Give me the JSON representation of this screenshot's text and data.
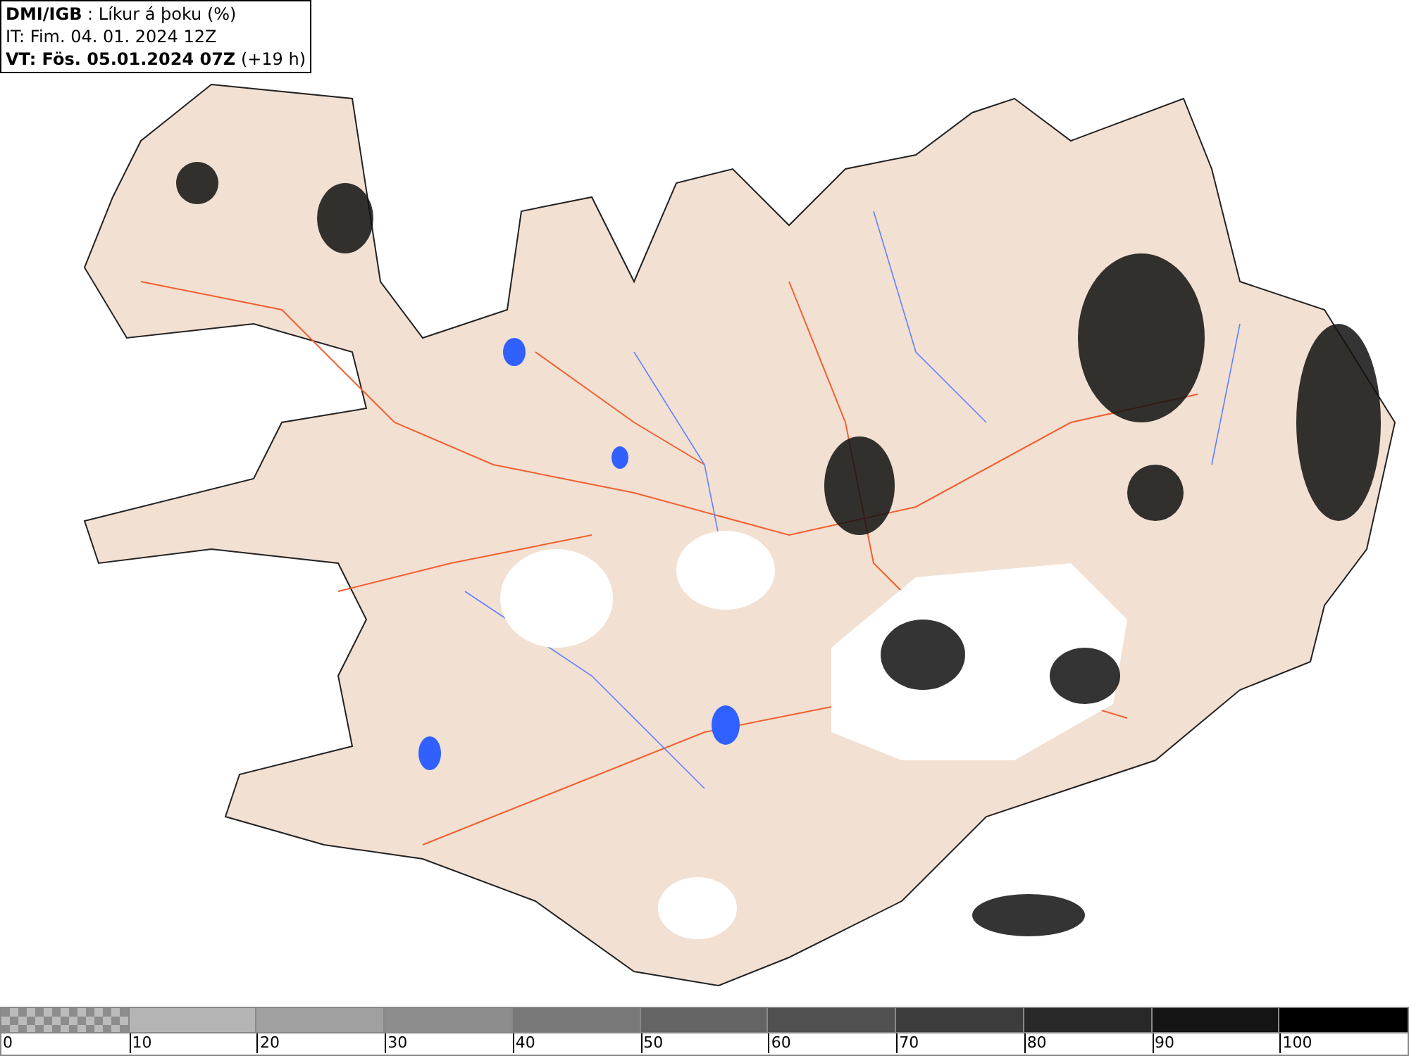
{
  "header": {
    "lines": [
      "**DMI/IGB** : Líkur á þoku (%)",
      "IT: Fim. 04. 01. 2024 12Z",
      "**VT: Fös. 05.01.2024 07Z** (+19 h)"
    ]
  },
  "colorbar": {
    "segments": [
      {
        "kind": "checker",
        "color": "#8c8c8c"
      },
      {
        "kind": "solid",
        "color": "#b4b4b4"
      },
      {
        "kind": "solid",
        "color": "#a0a0a0"
      },
      {
        "kind": "solid",
        "color": "#8c8c8c"
      },
      {
        "kind": "solid",
        "color": "#787878"
      },
      {
        "kind": "solid",
        "color": "#646464"
      },
      {
        "kind": "solid",
        "color": "#505050"
      },
      {
        "kind": "solid",
        "color": "#3c3c3c"
      },
      {
        "kind": "solid",
        "color": "#282828"
      },
      {
        "kind": "solid",
        "color": "#141414"
      },
      {
        "kind": "solid",
        "color": "#000000"
      }
    ],
    "labels": [
      "0",
      "10",
      "20",
      "30",
      "40",
      "50",
      "60",
      "70",
      "80",
      "90",
      "100"
    ]
  }
}
